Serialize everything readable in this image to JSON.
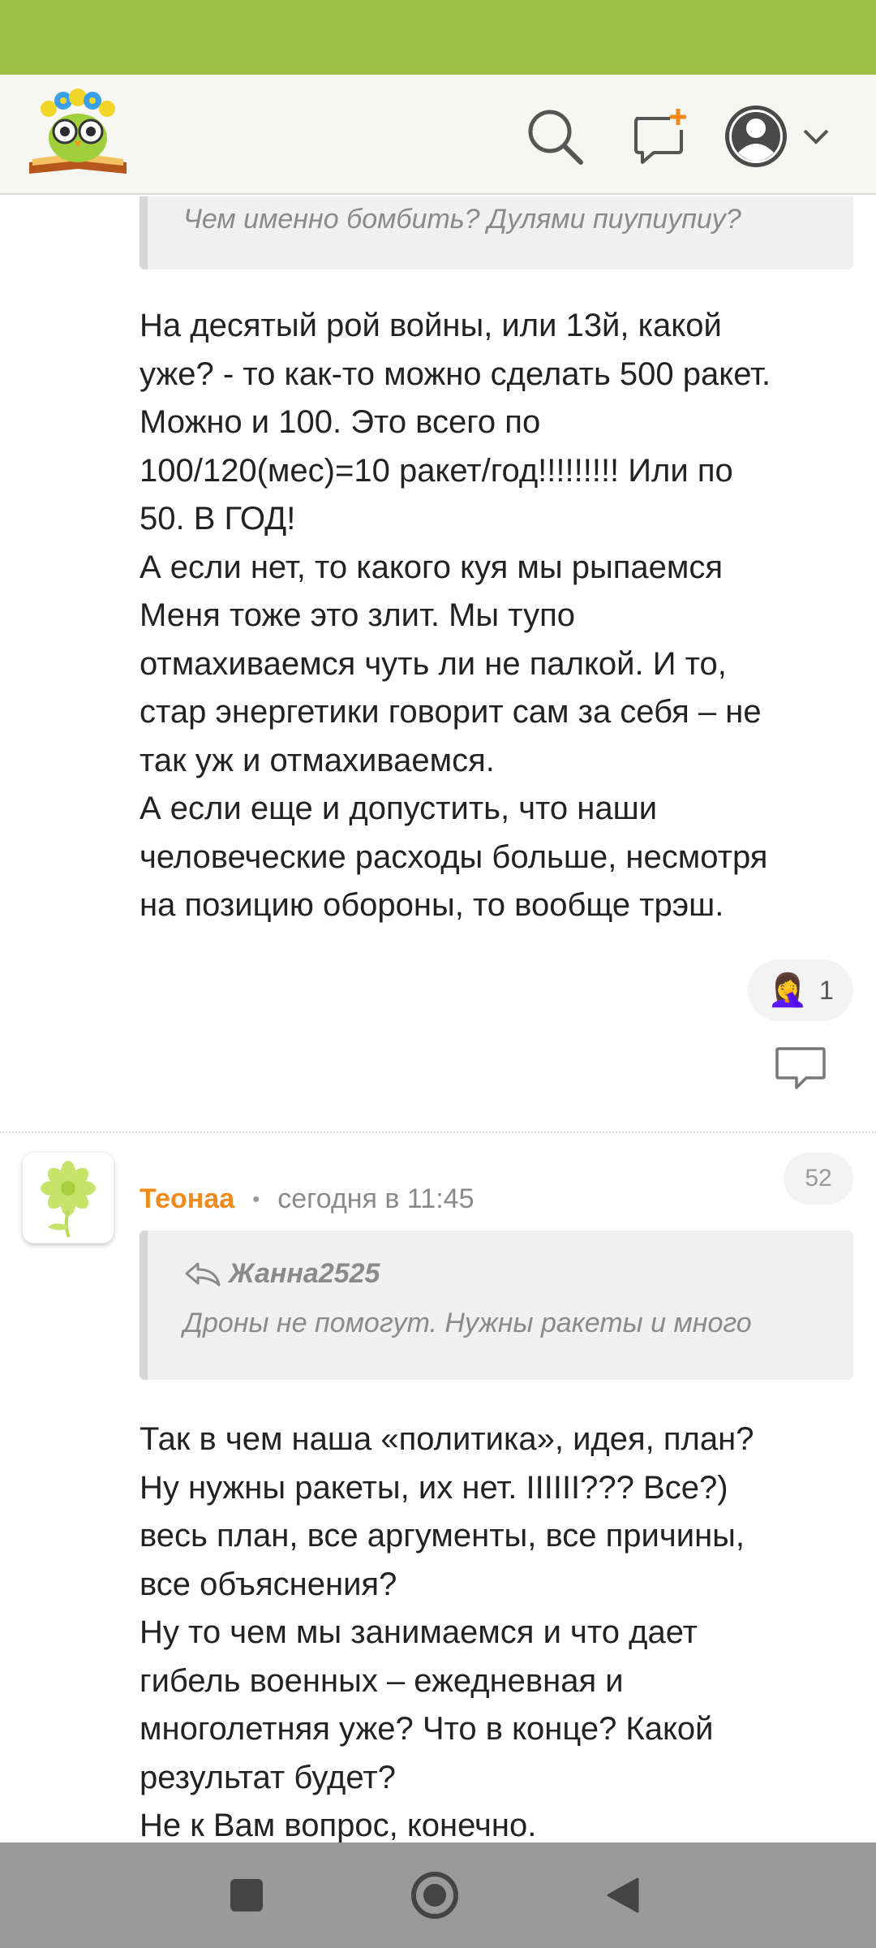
{
  "header": {
    "logo": "owl-reading-book-logo",
    "icons": {
      "search": "search-icon",
      "new_post": "new-post-icon",
      "profile": "user-avatar-icon",
      "menu": "chevron-down-icon"
    }
  },
  "comment_1": {
    "quote_text": "Чем именно бомбить? Дулями пиупиупиу?",
    "body": "На десятый рой войны, или 13й, какой\nуже? - то как-то можно сделать 500 ракет.\nМожно и 100. Это всего по\n100/120(мес)=10 ракет/год!!!!!!!!! Или по\n50. В ГОД!\nА если нет, то какого куя мы рыпаемся\nМеня тоже это злит. Мы тупо\nотмахиваемся чуть ли не палкой. И то,\nстар энергетики говорит сам за себя – не\nтак уж и отмахиваемся.\nА если еще и допустить, что наши\nчеловеческие расходы больше, несмотря\nна позицию обороны, то вообще трэш.",
    "reaction": {
      "emoji": "🤦‍♀️",
      "count": "1"
    },
    "reply_icon": "comment-icon"
  },
  "comment_2": {
    "username": "Теонаа",
    "separator": "•",
    "time": "сегодня в 11:45",
    "count": "52",
    "avatar_icon": "flower-icon",
    "quote_author": "Жанна2525",
    "quote_text": "Дроны не помогут. Нужны ракеты и много",
    "body": "Так в чем наша «политика», идея, план?\nНу нужны ракеты, их нет. IIIIII??? Все?)\nвесь план, все аргументы, все причины,\nвсе объяснения?\nНу то чем мы занимаемся и что дает\nгибель военных – ежедневная и\nмноголетняя уже? Что в конце? Какой\nрезультат будет?\nНе к Вам вопрос, конечно."
  },
  "nav": {
    "recents": "square-icon",
    "home": "circle-icon",
    "back": "triangle-back-icon"
  },
  "colors": {
    "status_bar": "#9dc244",
    "accent_username": "#f08a1c",
    "nav_bar": "#9a9a9a"
  }
}
